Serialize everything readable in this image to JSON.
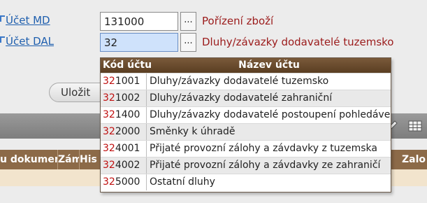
{
  "form": {
    "md": {
      "label": "Účet MD",
      "value": "131000",
      "button": "...",
      "description": "Pořízení zboží"
    },
    "dal": {
      "label": "Účet DAL",
      "value": "32",
      "button": "...",
      "description": "Dluhy/závazky dodavatelé tuzemsko"
    }
  },
  "save_button": "Uložit",
  "table": {
    "headers": [
      "u dokumenm",
      "Zám",
      "His",
      "Zalo"
    ]
  },
  "dropdown": {
    "headers": {
      "code": "Kód účtu",
      "name": "Název účtu"
    },
    "typed_prefix": "32",
    "rows": [
      {
        "prefix": "32",
        "rest": "1001",
        "name": "Dluhy/závazky dodavatelé tuzemsko"
      },
      {
        "prefix": "32",
        "rest": "1002",
        "name": "Dluhy/závazky dodavatelé zahraniční"
      },
      {
        "prefix": "32",
        "rest": "1400",
        "name": "Dluhy/závazky dodavatelé postoupení pohledávek"
      },
      {
        "prefix": "32",
        "rest": "2000",
        "name": "Směnky k úhradě"
      },
      {
        "prefix": "32",
        "rest": "4001",
        "name": "Přijaté provozní zálohy a závdavky z tuzemska"
      },
      {
        "prefix": "32",
        "rest": "4002",
        "name": "Přijaté provozní zálohy a závdavky ze zahraničí"
      },
      {
        "prefix": "32",
        "rest": "5000",
        "name": "Ostatní dluhy"
      }
    ]
  },
  "colors": {
    "link": "#1f5fae",
    "description": "#9b1b1b",
    "dropdown_header": "#5a3e22",
    "match_highlight": "#c01010",
    "focused_input": "#cfe2fb"
  }
}
